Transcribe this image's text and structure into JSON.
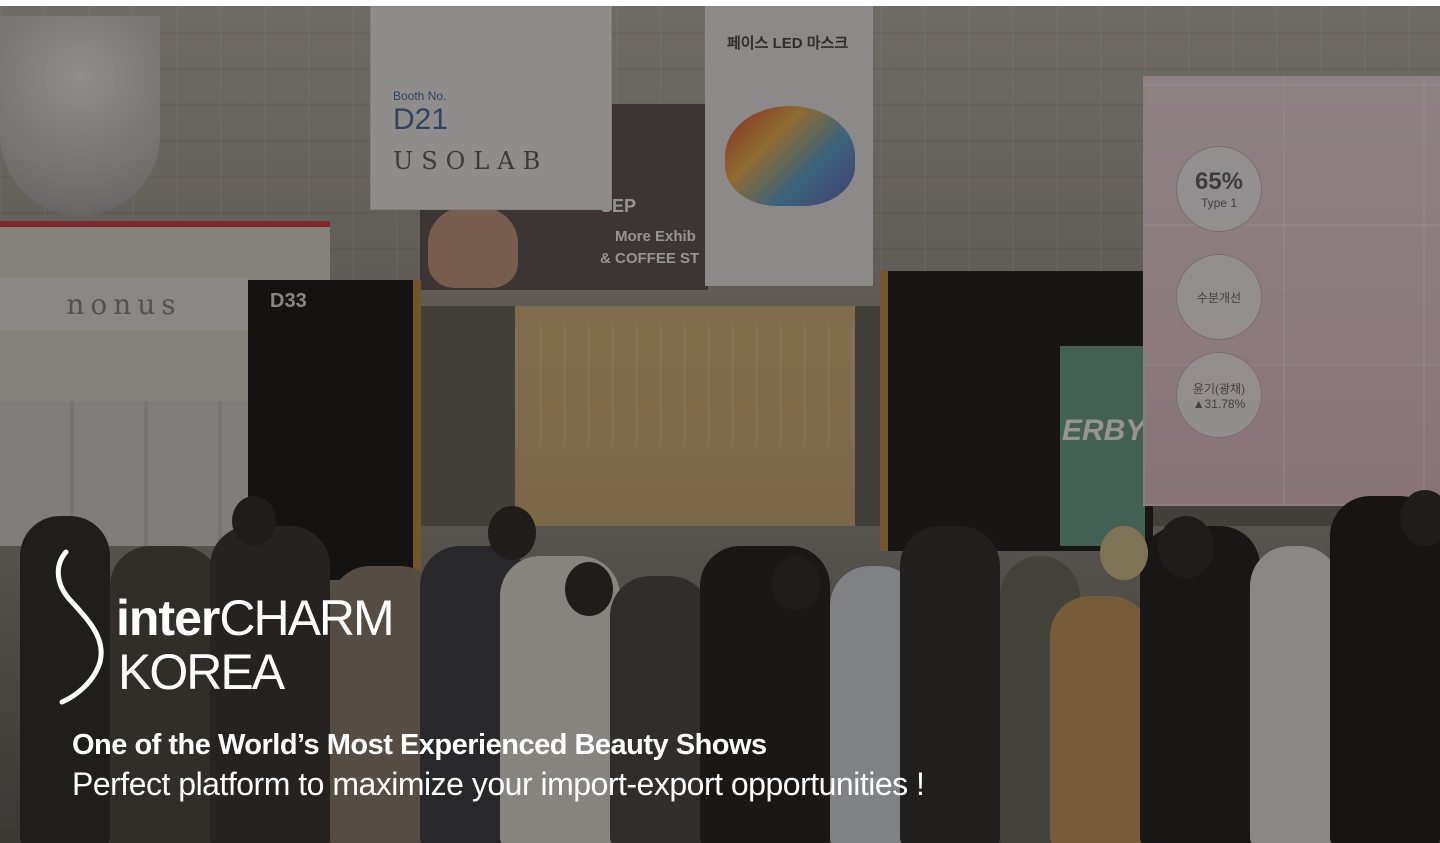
{
  "hero": {
    "logo": {
      "inter": "inter",
      "charm": "CHARM",
      "korea": "KOREA"
    },
    "headline": "One of the World’s Most Experienced Beauty Shows",
    "subheadline": "Perfect platform to maximize your import-export opportunities !"
  },
  "scene": {
    "booth_left_sign": "nonus",
    "booth_left_number": "D33",
    "banner_usolab": {
      "booth_no_label": "Booth No.",
      "booth_id": "D21",
      "brand": "USOLAB"
    },
    "banner_mask_title": "페이스 LED 마스크",
    "banner_dark": {
      "line1": "SEP",
      "line2": "More Exhib",
      "line3": "& COFFEE ST"
    },
    "booth_right_sign": "ERBY",
    "stats": [
      {
        "value": "65%",
        "label": "Type 1"
      },
      {
        "value": "수분개선",
        "label": ""
      },
      {
        "value": "윤기(광채)",
        "label": "▲31.78%"
      }
    ]
  },
  "colors": {
    "overlay": "#141210",
    "text": "#ffffff",
    "booth_accent": "#d53a4a",
    "frame_accent": "#c48a44"
  }
}
